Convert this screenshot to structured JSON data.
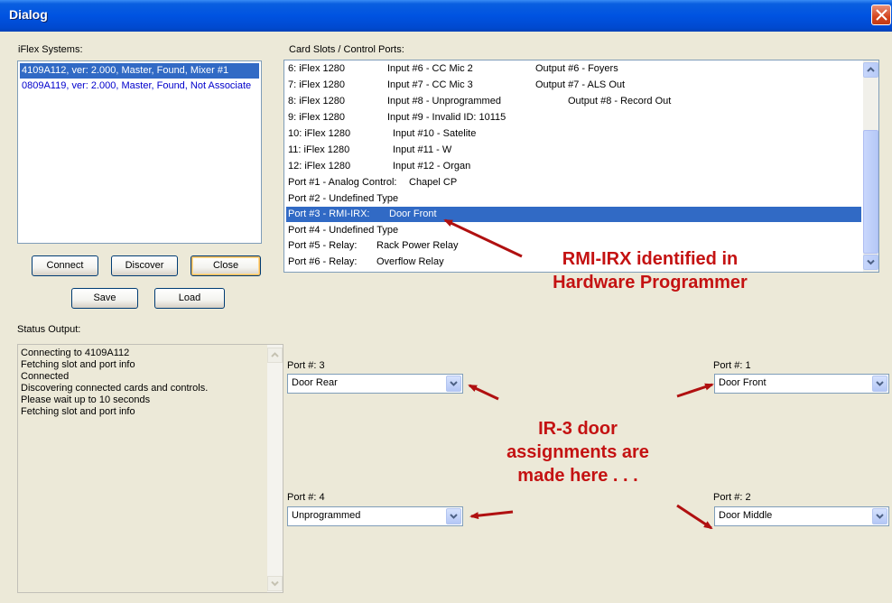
{
  "window": {
    "title": "Dialog"
  },
  "iflex": {
    "label": "iFlex Systems:",
    "items": [
      "4109A112, ver: 2.000, Master, Found, Mixer #1",
      "0809A119, ver: 2.000, Master, Found, Not Associate"
    ]
  },
  "buttons": {
    "connect": "Connect",
    "discover": "Discover",
    "close": "Close",
    "save": "Save",
    "load": "Load"
  },
  "slots": {
    "label": "Card Slots / Control Ports:",
    "rows": [
      {
        "a": "6:  iFlex 1280",
        "b": "Input #6 - CC Mic 2",
        "c": "Output #6 - Foyers"
      },
      {
        "a": "7:  iFlex 1280",
        "b": "Input #7 - CC Mic 3",
        "c": "Output #7 - ALS Out"
      },
      {
        "a": "8:  iFlex 1280",
        "b": "Input #8 - Unprogrammed",
        "c": "Output #8 - Record Out"
      },
      {
        "a": "9:  iFlex 1280",
        "b": "Input #9 - Invalid ID: 10115",
        "c": ""
      },
      {
        "a": "10:  iFlex 1280",
        "b": "Input #10 - Satelite",
        "c": ""
      },
      {
        "a": "11:  iFlex 1280",
        "b": "Input #11 - W",
        "c": ""
      },
      {
        "a": "12:  iFlex 1280",
        "b": "Input #12 - Organ",
        "c": ""
      },
      {
        "a": "Port #1 - Analog Control:",
        "b": "Chapel CP",
        "c": ""
      },
      {
        "a": "Port #2 - Undefined Type",
        "b": "",
        "c": ""
      },
      {
        "a": "Port #3 - RMI-IRX:",
        "b": "Door Front",
        "c": ""
      },
      {
        "a": "Port #4 - Undefined Type",
        "b": "",
        "c": ""
      },
      {
        "a": "Port #5 - Relay:",
        "b": "Rack Power Relay",
        "c": ""
      },
      {
        "a": "Port #6 - Relay:",
        "b": "Overflow Relay",
        "c": ""
      }
    ]
  },
  "status": {
    "label": "Status Output:",
    "lines": [
      "Connecting to 4109A112",
      "Fetching slot and port info",
      "Connected",
      "Discovering connected cards and controls.",
      "Please wait up to 10 seconds",
      "Fetching slot and port info"
    ]
  },
  "ports": {
    "p3": {
      "label": "Port #: 3",
      "value": "Door Rear"
    },
    "p1": {
      "label": "Port #: 1",
      "value": "Door Front"
    },
    "p4": {
      "label": "Port #: 4",
      "value": "Unprogrammed"
    },
    "p2": {
      "label": "Port #: 2",
      "value": "Door Middle"
    }
  },
  "annotations": {
    "rmi_line1": "RMI-IRX identified in",
    "rmi_line2": "Hardware Programmer",
    "ir_line1": "IR-3 door",
    "ir_line2": "assignments are",
    "ir_line3": "made here . . ."
  },
  "colors": {
    "title_blue": "#0053e1",
    "selection": "#316ac5",
    "second_item": "#0000cc",
    "annotation_red": "#c41212",
    "arrow_red": "#b01010"
  }
}
